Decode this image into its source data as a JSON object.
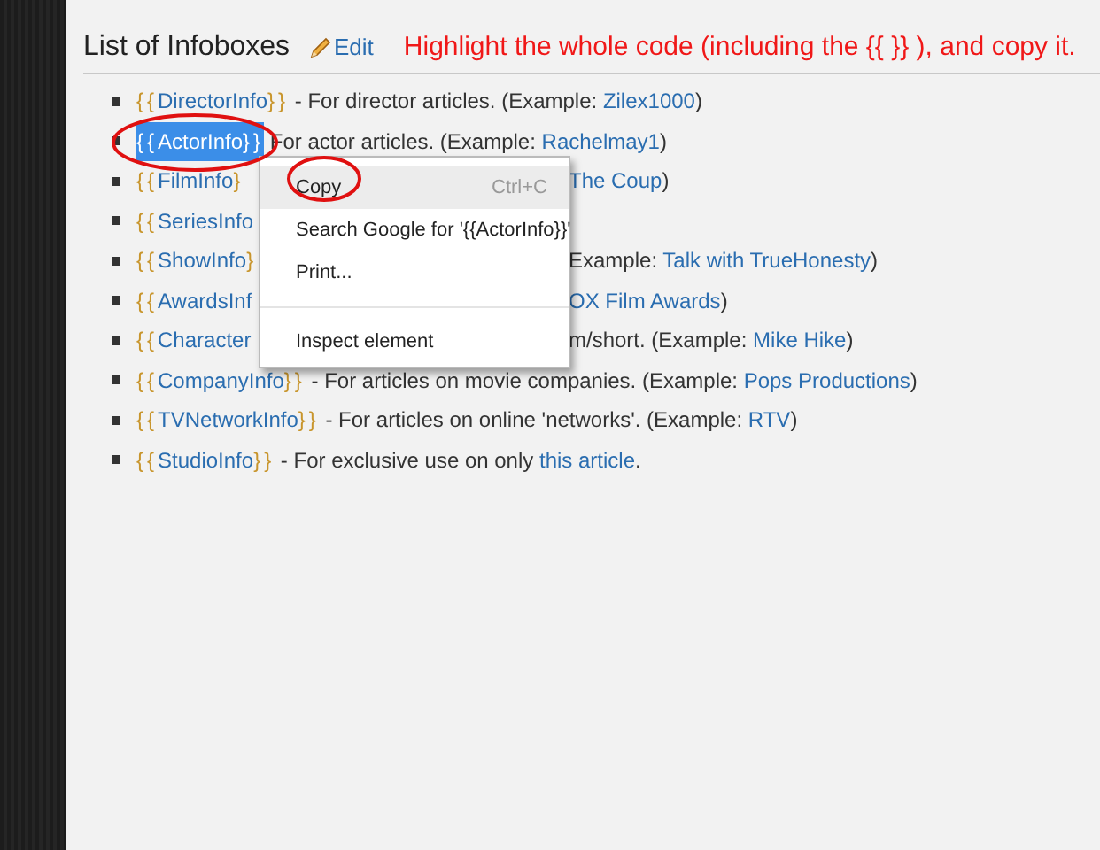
{
  "heading": {
    "title": "List of Infoboxes",
    "edit_link": "Edit"
  },
  "annotation": "Highlight the whole code (including the {{ }} ), and copy it.",
  "infoboxes": [
    {
      "open": "{{",
      "name": "DirectorInfo",
      "close": "}}",
      "selected": false,
      "parts": [
        {
          "kind": "text",
          "text": " - For director articles. (Example: "
        },
        {
          "kind": "link",
          "text": "Zilex1000"
        },
        {
          "kind": "text",
          "text": ")"
        }
      ]
    },
    {
      "open": "{{",
      "name": "ActorInfo",
      "close": "}}",
      "selected": true,
      "parts": [
        {
          "kind": "text",
          "text": " For actor articles. (Example: "
        },
        {
          "kind": "link",
          "text": "Rachelmay1"
        },
        {
          "kind": "text",
          "text": ")"
        }
      ]
    },
    {
      "open": "{{",
      "name": "FilmInfo",
      "close": "}",
      "selected": false,
      "after_menu": [
        {
          "kind": "link",
          "text": "The Coup"
        },
        {
          "kind": "text",
          "text": ")"
        }
      ]
    },
    {
      "open": "{{",
      "name": "SeriesInfo",
      "selected": false
    },
    {
      "open": "{{",
      "name": "ShowInfo",
      "close": "}",
      "selected": false,
      "after_menu": [
        {
          "kind": "text",
          "text": "Example: "
        },
        {
          "kind": "link",
          "text": "Talk with TrueHonesty"
        },
        {
          "kind": "text",
          "text": ")"
        }
      ]
    },
    {
      "open": "{{",
      "name": "AwardsInf",
      "selected": false,
      "after_menu": [
        {
          "kind": "link",
          "text": "OX Film Awards"
        },
        {
          "kind": "text",
          "text": ")"
        }
      ]
    },
    {
      "open": "{{",
      "name": "Character",
      "selected": false,
      "after_menu": [
        {
          "kind": "text",
          "text": "m/short. (Example: "
        },
        {
          "kind": "link",
          "text": "Mike Hike"
        },
        {
          "kind": "text",
          "text": ")"
        }
      ]
    },
    {
      "open": "{{",
      "name": "CompanyInfo",
      "close": "}}",
      "selected": false,
      "parts": [
        {
          "kind": "text",
          "text": " - For articles on movie companies. (Example: "
        },
        {
          "kind": "link",
          "text": "Pops Productions"
        },
        {
          "kind": "text",
          "text": ")"
        }
      ]
    },
    {
      "open": "{{",
      "name": "TVNetworkInfo",
      "close": "}}",
      "selected": false,
      "parts": [
        {
          "kind": "text",
          "text": " - For articles on online 'networks'. (Example: "
        },
        {
          "kind": "link",
          "text": "RTV"
        },
        {
          "kind": "text",
          "text": ")"
        }
      ]
    },
    {
      "open": "{{",
      "name": "StudioInfo",
      "close": "}}",
      "selected": false,
      "parts": [
        {
          "kind": "text",
          "text": " - For exclusive use on only "
        },
        {
          "kind": "link",
          "text": "this article"
        },
        {
          "kind": "text",
          "text": "."
        }
      ]
    }
  ],
  "context_menu": {
    "items": [
      {
        "kind": "item",
        "label": "Copy",
        "shortcut": "Ctrl+C",
        "selected": true
      },
      {
        "kind": "item",
        "label": "Search Google for '{{ActorInfo}}'",
        "selected": false
      },
      {
        "kind": "item",
        "label": "Print...",
        "selected": false
      },
      {
        "kind": "separator"
      },
      {
        "kind": "item",
        "label": "Inspect element",
        "selected": false
      }
    ]
  }
}
